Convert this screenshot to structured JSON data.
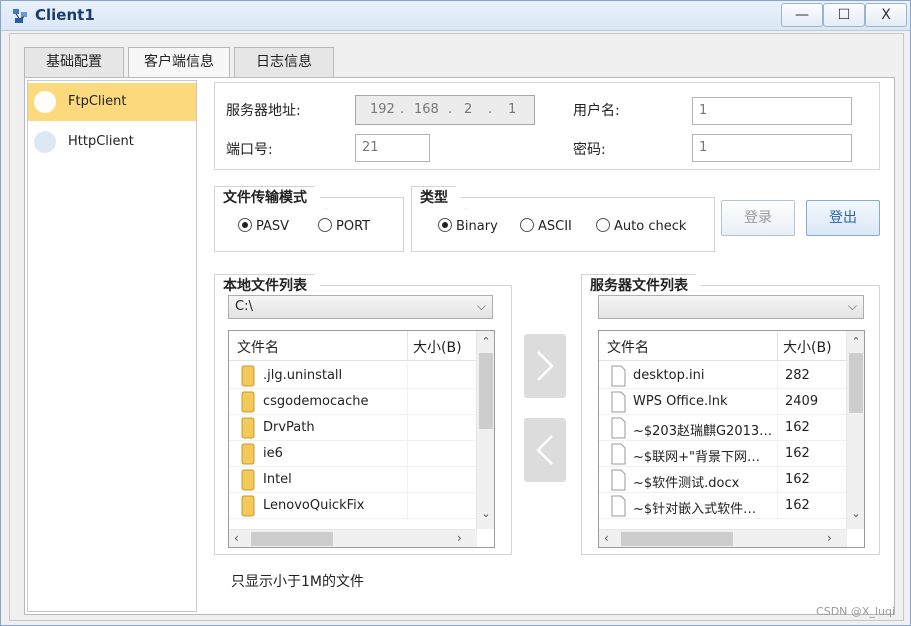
{
  "window": {
    "title": "Client1",
    "minimize": "—",
    "maximize": "☐",
    "close": "X"
  },
  "tabs": [
    {
      "label": "基础配置"
    },
    {
      "label": "客户端信息"
    },
    {
      "label": "日志信息"
    }
  ],
  "sidebar": {
    "items": [
      {
        "label": "FtpClient"
      },
      {
        "label": "HttpClient"
      }
    ]
  },
  "server": {
    "address_label": "服务器地址:",
    "ip": [
      "192",
      ".",
      "168",
      ".",
      "2",
      ".",
      "1"
    ],
    "username_label": "用户名:",
    "username": "1",
    "port_label": "端口号:",
    "port": "21",
    "password_label": "密码:",
    "password": "1"
  },
  "transfer_mode": {
    "legend": "文件传输模式",
    "options": [
      "PASV",
      "PORT"
    ],
    "selected": "PASV"
  },
  "type": {
    "legend": "类型",
    "options": [
      "Binary",
      "ASCII",
      "Auto check"
    ],
    "selected": "Binary"
  },
  "actions": {
    "login": "登录",
    "logout": "登出"
  },
  "local": {
    "legend": "本地文件列表",
    "path": "C:\\",
    "headers": [
      "文件名",
      "大小(B)"
    ],
    "files": [
      {
        "name": ".jlg.uninstall",
        "size": ""
      },
      {
        "name": "csgodemocache",
        "size": ""
      },
      {
        "name": "DrvPath",
        "size": ""
      },
      {
        "name": "ie6",
        "size": ""
      },
      {
        "name": "Intel",
        "size": ""
      },
      {
        "name": "LenovoQuickFix",
        "size": ""
      }
    ]
  },
  "remote": {
    "legend": "服务器文件列表",
    "path": "",
    "headers": [
      "文件名",
      "大小(B)"
    ],
    "files": [
      {
        "name": "desktop.ini",
        "size": "282"
      },
      {
        "name": "WPS Office.lnk",
        "size": "2409"
      },
      {
        "name": "~$203赵瑞麒G2013…",
        "size": "162"
      },
      {
        "name": "~$联网+\"背景下网…",
        "size": "162"
      },
      {
        "name": "~$软件测试.docx",
        "size": "162"
      },
      {
        "name": "~$针对嵌入式软件…",
        "size": "162"
      }
    ]
  },
  "transfer_buttons": {
    "upload": ">",
    "download": "<"
  },
  "footer_note": "只显示小于1M的文件",
  "watermark": "CSDN @X_luqi",
  "colors": {
    "selected_item": "#fcd97c",
    "folder": "#f2c95a",
    "logout_text": "#2863b0"
  }
}
